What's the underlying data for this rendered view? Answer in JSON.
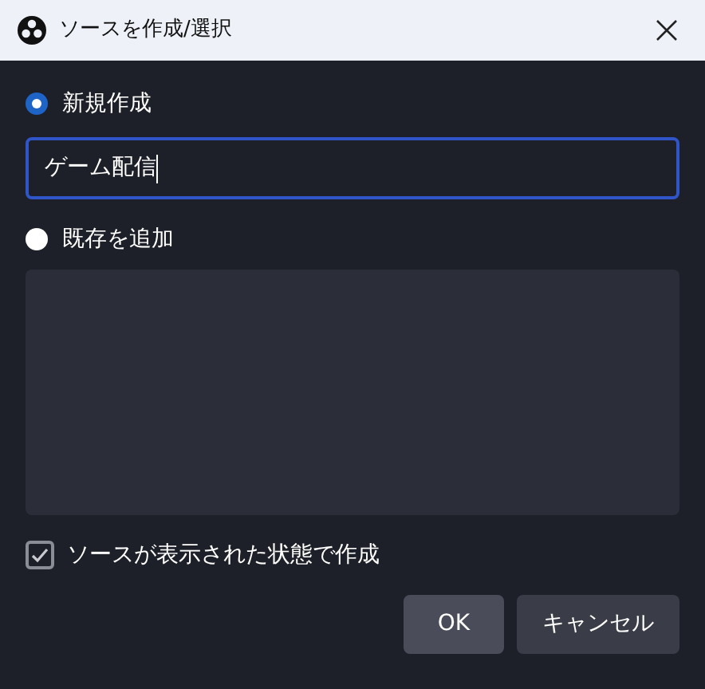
{
  "window": {
    "title": "ソースを作成/選択"
  },
  "options": [
    {
      "label": "新規作成",
      "selected": true
    },
    {
      "label": "既存を追加",
      "selected": false
    }
  ],
  "name_field": {
    "value": "ゲーム配信"
  },
  "visible_checkbox": {
    "label": "ソースが表示された状態で作成",
    "checked": true
  },
  "buttons": [
    {
      "label": "OK",
      "kind": "primary"
    },
    {
      "label": "キャンセル",
      "kind": "secondary"
    }
  ]
}
